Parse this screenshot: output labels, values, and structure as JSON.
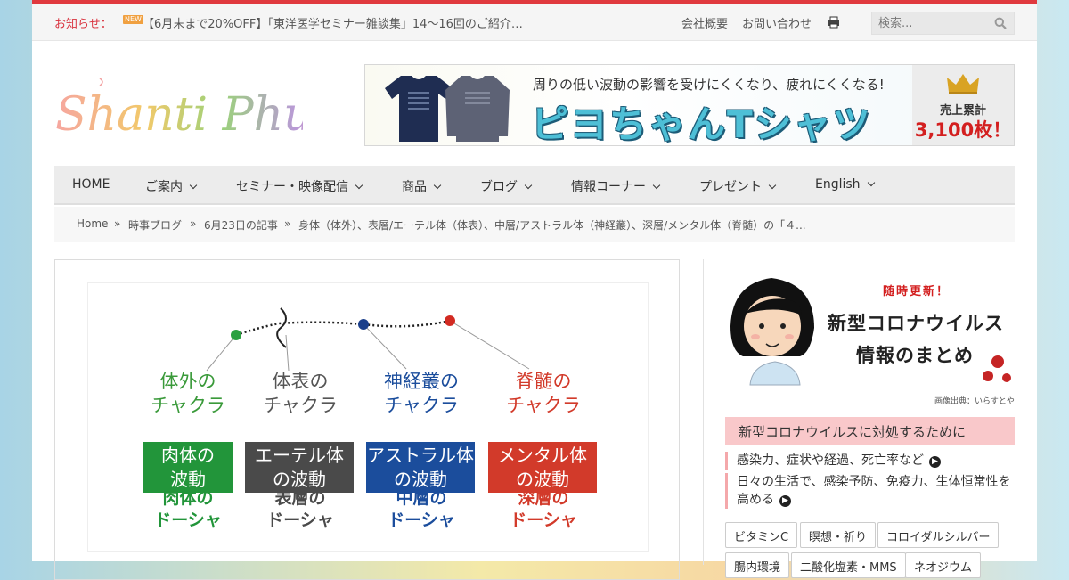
{
  "topbar": {
    "notice_label": "お知らせ：",
    "new_badge": "NEW",
    "notice_text": "【6月末まで20%OFF】「東洋医学セミナー雑談集」14〜16回のご紹介…",
    "links": [
      "会社概要",
      "お問い合わせ"
    ],
    "search_placeholder": "検索..."
  },
  "header": {
    "logo_text": "Shanti Phula",
    "banner": {
      "subtitle": "周りの低い波動の影響を受けにくくなり、疲れにくくなる!",
      "title": "ピヨちゃんTシャツ",
      "sales_label": "売上累計",
      "sales_value": "3,100枚！"
    }
  },
  "nav": {
    "items": [
      {
        "label": "HOME",
        "has_dropdown": false
      },
      {
        "label": "ご案内",
        "has_dropdown": true
      },
      {
        "label": "セミナー・映像配信",
        "has_dropdown": true
      },
      {
        "label": "商品",
        "has_dropdown": true
      },
      {
        "label": "ブログ",
        "has_dropdown": true
      },
      {
        "label": "情報コーナー",
        "has_dropdown": true
      },
      {
        "label": "プレゼント",
        "has_dropdown": true
      },
      {
        "label": "English",
        "has_dropdown": true
      }
    ]
  },
  "breadcrumb": {
    "items": [
      "Home",
      "時事ブログ",
      "6月23日の記事",
      "身体（体外）、表層/エーテル体（体表）、中層/アストラル体（神経叢）、深層/メンタル体（脊髄）の「４..."
    ],
    "separator": "»"
  },
  "figure": {
    "columns": [
      {
        "top": [
          "体外の",
          "チャクラ"
        ],
        "box": [
          "肉体の",
          "波動"
        ],
        "bottom": [
          "肉体の",
          "ドーシャ"
        ],
        "top_color": "#3a9a3a",
        "box_color": "#22953a",
        "bottom_color": "#22953a"
      },
      {
        "top": [
          "体表の",
          "チャクラ"
        ],
        "box": [
          "エーテル体",
          "の波動"
        ],
        "bottom": [
          "表層の",
          "ドーシャ"
        ],
        "top_color": "#555555",
        "box_color": "#4a4a4a",
        "bottom_color": "#4a4a4a"
      },
      {
        "top": [
          "神経叢の",
          "チャクラ"
        ],
        "box": [
          "アストラル体",
          "の波動"
        ],
        "bottom": [
          "中層の",
          "ドーシャ"
        ],
        "top_color": "#1b4d9c",
        "box_color": "#1b4d9c",
        "bottom_color": "#1b4d9c"
      },
      {
        "top": [
          "脊髄の",
          "チャクラ"
        ],
        "box": [
          "メンタル体",
          "の波動"
        ],
        "bottom": [
          "深層の",
          "ドーシャ"
        ],
        "top_color": "#d23a2a",
        "box_color": "#d23a2a",
        "bottom_color": "#d23a2a"
      }
    ]
  },
  "sidebar": {
    "promo": {
      "tag": "随時更新！",
      "title_line1": "新型コロナウイルス",
      "title_line2": "情報のまとめ",
      "credit": "画像出典：いらすとや"
    },
    "section_title": "新型コロナウイルスに対処するために",
    "links": [
      [
        "感染力、症状や経過、死亡率など"
      ],
      [
        "日々の生活で、感染予防、免疫力、生体恒常性を",
        "高める"
      ]
    ],
    "tags": [
      "ビタミンC",
      "瞑想・祈り",
      "コロイダルシルバー",
      "腸内環境",
      "二酸化塩素・MMS",
      "ネオジウム"
    ]
  }
}
